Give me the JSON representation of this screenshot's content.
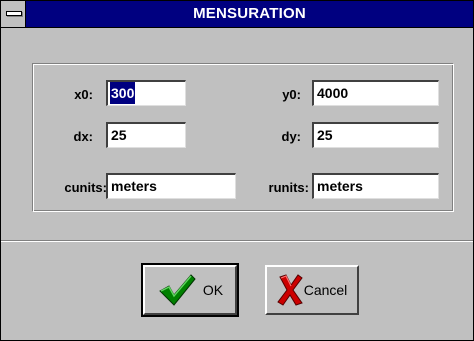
{
  "window": {
    "title": "MENSURATION"
  },
  "fields": {
    "x0": {
      "label": "x0:",
      "value": "300"
    },
    "y0": {
      "label": "y0:",
      "value": "4000"
    },
    "dx": {
      "label": "dx:",
      "value": "25"
    },
    "dy": {
      "label": "dy:",
      "value": "25"
    },
    "cunits": {
      "label": "cunits:",
      "value": "meters"
    },
    "runits": {
      "label": "runits:",
      "value": "meters"
    }
  },
  "buttons": {
    "ok": {
      "label": "OK",
      "icon": "checkmark-icon"
    },
    "cancel": {
      "label": "Cancel",
      "icon": "red-x-icon"
    }
  },
  "colors": {
    "titlebar": "#000080",
    "face": "#c0c0c0",
    "selection": "#000080",
    "check": "#008000",
    "cross": "#cc0000"
  }
}
